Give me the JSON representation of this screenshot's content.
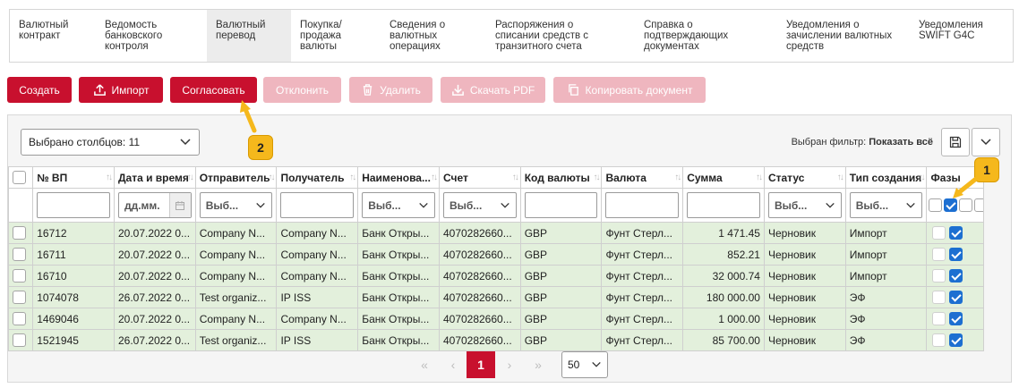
{
  "tabs": [
    {
      "label": "Валютный\nконтракт"
    },
    {
      "label": "Ведомость\nбанковского\nконтроля"
    },
    {
      "label": "Валютный\nперевод"
    },
    {
      "label": "Покупка/\nпродажа\nвалюты"
    },
    {
      "label": "Сведения о\nвалютных\nоперациях"
    },
    {
      "label": "Распоряжения о\nсписании средств с\nтранзитного счета"
    },
    {
      "label": "Справка о\nподтверждающих\nдокументах"
    },
    {
      "label": "Уведомления о\nзачислении валютных\nсредств"
    },
    {
      "label": "Уведомления\nSWIFT G4C"
    }
  ],
  "toolbar": {
    "create": "Создать",
    "import": "Импорт",
    "approve": "Согласовать",
    "reject": "Отклонить",
    "delete": "Удалить",
    "download_pdf": "Скачать PDF",
    "copy_doc": "Копировать документ"
  },
  "grid": {
    "columns_selected": "Выбрано столбцов: 11",
    "filter_label": "Выбран фильтр:",
    "filter_value": "Показать всё",
    "headers": {
      "num": "№ ВП",
      "date": "Дата и время",
      "sender": "Отправитель",
      "receiver": "Получатель",
      "name": "Наименова...",
      "account": "Счет",
      "currency_code": "Код валюты",
      "currency": "Валюта",
      "amount": "Сумма",
      "status": "Статус",
      "creation_type": "Тип создания",
      "phases": "Фазы"
    },
    "filters": {
      "date_placeholder": "дд.мм.",
      "select_placeholder": "Выб..."
    },
    "rows": [
      {
        "num": "16712",
        "date": "20.07.2022 0...",
        "sender": "Company N...",
        "receiver": "Company N...",
        "name": "Банк Откры...",
        "account": "4070282660...",
        "code": "GBP",
        "currency": "Фунт Стерл...",
        "amount": "1 471.45",
        "status": "Черновик",
        "type": "Импорт"
      },
      {
        "num": "16711",
        "date": "20.07.2022 0...",
        "sender": "Company N...",
        "receiver": "Company N...",
        "name": "Банк Откры...",
        "account": "4070282660...",
        "code": "GBP",
        "currency": "Фунт Стерл...",
        "amount": "852.21",
        "status": "Черновик",
        "type": "Импорт"
      },
      {
        "num": "16710",
        "date": "20.07.2022 0...",
        "sender": "Company N...",
        "receiver": "Company N...",
        "name": "Банк Откры...",
        "account": "4070282660...",
        "code": "GBP",
        "currency": "Фунт Стерл...",
        "amount": "32 000.74",
        "status": "Черновик",
        "type": "Импорт"
      },
      {
        "num": "1074078",
        "date": "26.07.2022 0...",
        "sender": "Test organiz...",
        "receiver": "IP ISS",
        "name": "Банк Откры...",
        "account": "4070282660...",
        "code": "GBP",
        "currency": "Фунт Стерл...",
        "amount": "180 000.00",
        "status": "Черновик",
        "type": "ЭФ"
      },
      {
        "num": "1469046",
        "date": "20.07.2022 0...",
        "sender": "Company N...",
        "receiver": "Company N...",
        "name": "Банк Откры...",
        "account": "4070282660...",
        "code": "GBP",
        "currency": "Фунт Стерл...",
        "amount": "1 000.00",
        "status": "Черновик",
        "type": "ЭФ"
      },
      {
        "num": "1521945",
        "date": "26.07.2022 0...",
        "sender": "Test organiz...",
        "receiver": "IP ISS",
        "name": "Банк Откры...",
        "account": "4070282660...",
        "code": "GBP",
        "currency": "Фунт Стерл...",
        "amount": "85 700.00",
        "status": "Черновик",
        "type": "ЭФ"
      }
    ]
  },
  "pager": {
    "first": "«",
    "prev": "‹",
    "current": "1",
    "next": "›",
    "last": "»",
    "page_size": "50"
  },
  "markers": {
    "one": "1",
    "two": "2"
  },
  "colors": {
    "accent": "#c8102e",
    "accent_disabled": "#efb6bf",
    "row_bg": "#e3f0dc",
    "checkbox": "#1d6fd1",
    "marker": "#f5b81c"
  }
}
